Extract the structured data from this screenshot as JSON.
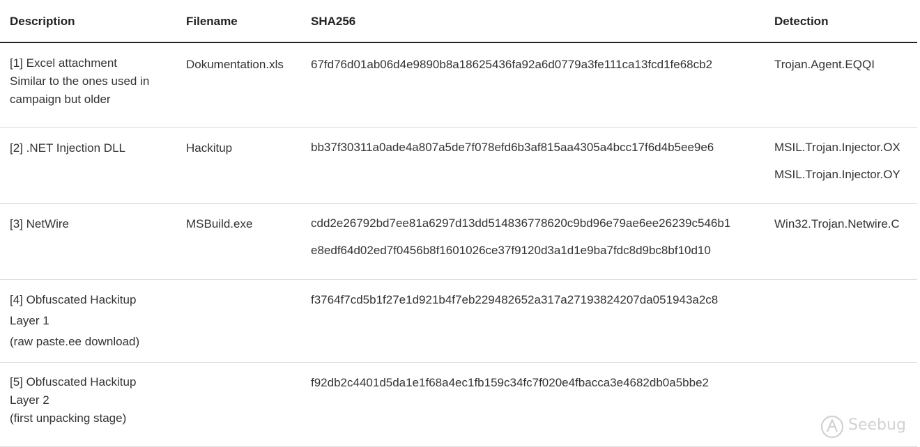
{
  "table": {
    "headers": {
      "description": "Description",
      "filename": "Filename",
      "sha256": "SHA256",
      "detection": "Detection"
    },
    "rows": [
      {
        "description": [
          "[1] Excel attachment",
          "Similar to the ones used in",
          "campaign but older"
        ],
        "filename": "Dokumentation.xls",
        "sha256": [
          "67fd76d01ab06d4e9890b8a18625436fa92a6d0779a3fe111ca13fcd1fe68cb2"
        ],
        "detection": [
          "Trojan.Agent.EQQI"
        ]
      },
      {
        "description": [
          "[2] .NET Injection DLL"
        ],
        "filename": "Hackitup",
        "sha256": [
          "bb37f30311a0ade4a807a5de7f078efd6b3af815aa4305a4bcc17f6d4b5ee9e6"
        ],
        "detection": [
          "MSIL.Trojan.Injector.OX",
          "MSIL.Trojan.Injector.OY"
        ]
      },
      {
        "description": [
          "[3] NetWire"
        ],
        "filename": "MSBuild.exe",
        "sha256": [
          "cdd2e26792bd7ee81a6297d13dd514836778620c9bd96e79ae6ee26239c546b1",
          "e8edf64d02ed7f0456b8f1601026ce37f9120d3a1d1e9ba7fdc8d9bc8bf10d10"
        ],
        "detection": [
          "Win32.Trojan.Netwire.C"
        ]
      },
      {
        "description": [
          "[4] Obfuscated Hackitup",
          "Layer 1",
          "(raw paste.ee download)"
        ],
        "filename": "",
        "sha256": [
          "f3764f7cd5b1f27e1d921b4f7eb229482652a317a27193824207da051943a2c8"
        ],
        "detection": []
      },
      {
        "description": [
          "[5] Obfuscated Hackitup",
          "Layer 2",
          "(first unpacking stage)"
        ],
        "filename": "",
        "sha256": [
          "f92db2c4401d5da1e1f68a4ec1fb159c34fc7f020e4fbacca3e4682db0a5bbe2"
        ],
        "detection": []
      }
    ]
  },
  "watermark": {
    "text": "Seebug",
    "icon": "seebug-logo-icon"
  }
}
